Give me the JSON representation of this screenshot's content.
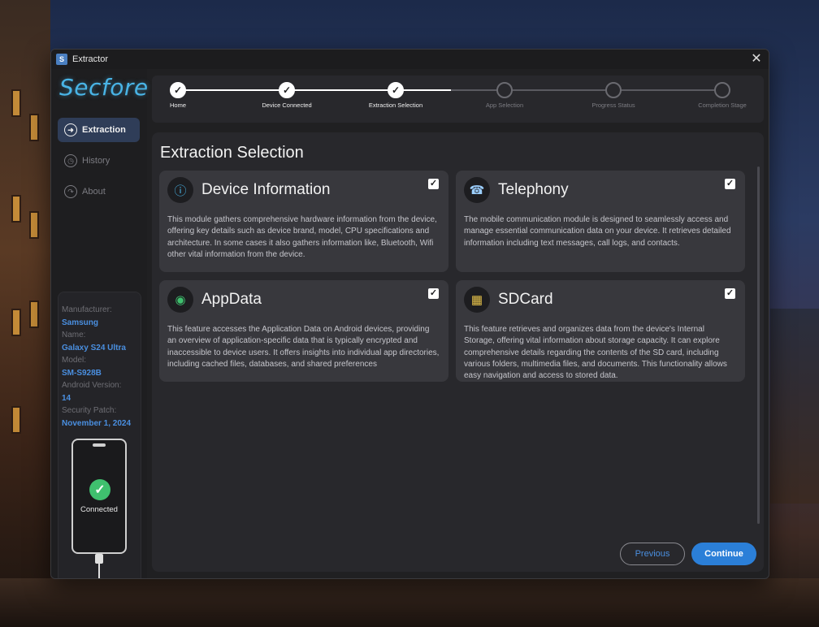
{
  "window": {
    "title": "Extractor",
    "app_icon_text": "S",
    "close_glyph": "✕"
  },
  "sidebar": {
    "brand": "Secfore",
    "nav": [
      {
        "label": "Extraction",
        "icon": "exit-arrow-icon",
        "active": true
      },
      {
        "label": "History",
        "icon": "clock-icon",
        "active": false
      },
      {
        "label": "About",
        "icon": "info-icon",
        "active": false
      }
    ],
    "device": {
      "manufacturer_label": "Manufacturer:",
      "manufacturer": "Samsung",
      "name_label": "Name:",
      "name": "Galaxy S24 Ultra",
      "model_label": "Model:",
      "model": "SM-S928B",
      "android_label": "Android Version:",
      "android": "14",
      "patch_label": "Security Patch:",
      "patch": "November 1, 2024",
      "status": "Connected"
    }
  },
  "steps": [
    {
      "label": "Home",
      "done": true
    },
    {
      "label": "Device Connected",
      "done": true
    },
    {
      "label": "Extraction Selection",
      "done": true
    },
    {
      "label": "App Selection",
      "done": false
    },
    {
      "label": "Progress Status",
      "done": false
    },
    {
      "label": "Completion Stage",
      "done": false
    }
  ],
  "main": {
    "title": "Extraction Selection",
    "cards": [
      {
        "title": "Device Information",
        "icon": "device-info-icon",
        "checked": true,
        "desc": "This module gathers comprehensive hardware information from the device, offering key details such as device brand, model, CPU specifications and architecture. In some cases it also gathers information like, Bluetooth, Wifi  other vital information from the device."
      },
      {
        "title": "Telephony",
        "icon": "telephony-icon",
        "checked": true,
        "desc": "The mobile communication module is designed to seamlessly access and manage essential communication data on your device. It retrieves detailed information including text messages, call logs, and contacts."
      },
      {
        "title": "AppData",
        "icon": "appdata-icon",
        "checked": true,
        "desc": "This feature accesses the Application Data on Android devices, providing an overview of application-specific data that is typically encrypted and inaccessible to device users. It offers insights into individual app directories, including cached files, databases, and shared preferences"
      },
      {
        "title": "SDCard",
        "icon": "sdcard-icon",
        "checked": true,
        "desc": "This feature retrieves and organizes data from the device's Internal Storage, offering vital information about storage capacity. It can explore comprehensive details regarding the contents of the SD card, including various folders, multimedia files, and documents. This functionality allows easy navigation and access to stored data."
      }
    ],
    "previous_label": "Previous",
    "continue_label": "Continue"
  },
  "colors": {
    "accent": "#2b7fd8",
    "brand": "#49b4e6",
    "success": "#3fc06e"
  }
}
